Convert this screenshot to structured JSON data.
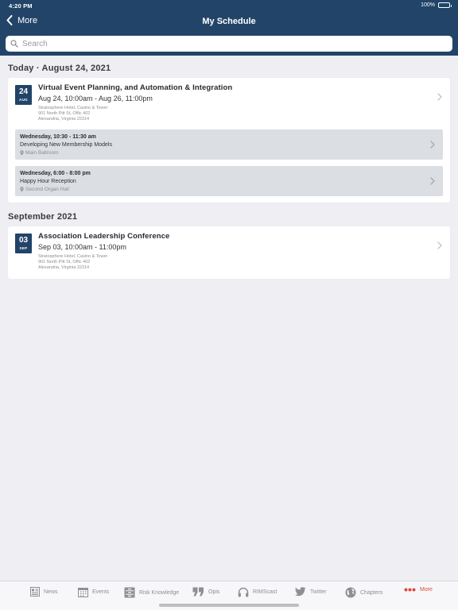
{
  "status": {
    "time": "4:20 PM",
    "battery": "100%"
  },
  "nav": {
    "back_label": "More",
    "title": "My Schedule"
  },
  "search": {
    "placeholder": "Search"
  },
  "sections": [
    {
      "title": "Today · August 24, 2021",
      "event": {
        "day": "24",
        "month": "AUG",
        "title": "Virtual Event Planning, and Automation & Integration",
        "time": "Aug 24, 10:00am - Aug 26, 11:00pm",
        "address": [
          "Stratosphere Hotel, Casino & Tower",
          "901 North Pitt St, Offic 402",
          "Alexandria, Virginia 22314"
        ],
        "sessions": [
          {
            "time": "Wednesday, 10:30 - 11:30 am",
            "title": "Developing New Membership Models",
            "location": "Main Ballroom"
          },
          {
            "time": "Wednesday, 6:00 - 8:00 pm",
            "title": "Happy Hour Reception",
            "location": "Second Organ Hall"
          }
        ]
      }
    },
    {
      "title": "September 2021",
      "event": {
        "day": "03",
        "month": "SEP",
        "title": "Association Leadership Conference",
        "time": "Sep 03, 10:00am - 11:00pm",
        "address": [
          "Stratosphere Hotel, Casino & Tower",
          "901 North Pitt St, Offic 402",
          "Alexandria, Virginia 22314"
        ],
        "sessions": []
      }
    }
  ],
  "tabs": [
    {
      "label": "News",
      "icon": "news-icon"
    },
    {
      "label": "Events",
      "icon": "calendar-icon"
    },
    {
      "label": "Risk Knowledge",
      "icon": "cabinet-icon"
    },
    {
      "label": "Opis",
      "icon": "quote-icon"
    },
    {
      "label": "RIMScast",
      "icon": "headphones-icon"
    },
    {
      "label": "Twitter",
      "icon": "twitter-icon"
    },
    {
      "label": "Chapters",
      "icon": "globe-icon"
    },
    {
      "label": "More",
      "icon": "more-icon",
      "active": true
    }
  ],
  "colors": {
    "header": "#224469",
    "background": "#eeeef3",
    "accent": "#e0483d",
    "session_bg": "#dbdee3"
  }
}
